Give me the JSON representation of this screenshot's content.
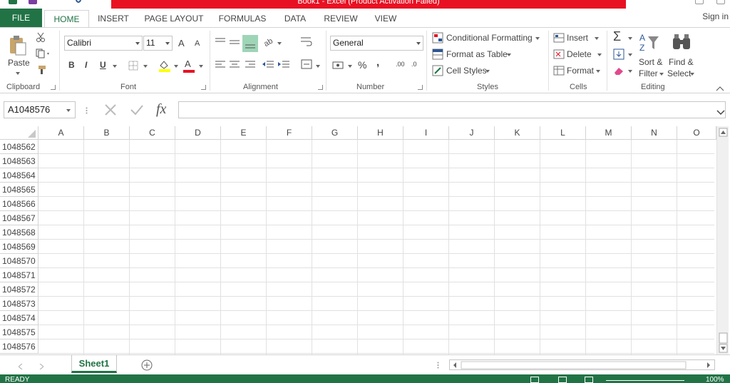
{
  "title_bar": {
    "title": "Book1 - Excel (Product Activation Failed)"
  },
  "tabs": [
    {
      "label": "FILE",
      "key": "file"
    },
    {
      "label": "HOME",
      "key": "home"
    },
    {
      "label": "INSERT",
      "key": "insert"
    },
    {
      "label": "PAGE LAYOUT",
      "key": "page-layout"
    },
    {
      "label": "FORMULAS",
      "key": "formulas"
    },
    {
      "label": "DATA",
      "key": "data"
    },
    {
      "label": "REVIEW",
      "key": "review"
    },
    {
      "label": "VIEW",
      "key": "view"
    }
  ],
  "active_tab": "HOME",
  "signin": "Sign in",
  "ribbon": {
    "clipboard": {
      "label": "Clipboard",
      "paste": "Paste"
    },
    "font": {
      "label": "Font",
      "name": "Calibri",
      "size": "11",
      "bold": "B",
      "italic": "I",
      "underline": "U",
      "grow": "A",
      "shrink": "A",
      "fontcolor": "A"
    },
    "alignment": {
      "label": "Alignment"
    },
    "number": {
      "label": "Number",
      "format": "General",
      "percent": "%",
      "comma": ",",
      "inc_decimal": ".00",
      "dec_decimal": ".0"
    },
    "styles": {
      "label": "Styles",
      "conditional": "Conditional Formatting",
      "table": "Format as Table",
      "cell_styles": "Cell Styles"
    },
    "cells": {
      "label": "Cells",
      "insert": "Insert",
      "delete": "Delete",
      "format": "Format"
    },
    "editing": {
      "label": "Editing",
      "sort_line1": "Sort &",
      "sort_line2": "Filter",
      "find_line1": "Find &",
      "find_line2": "Select",
      "sigma": "Σ"
    }
  },
  "formula_bar": {
    "name_box": "A1048576",
    "fx": "fx",
    "value": ""
  },
  "columns": [
    "A",
    "B",
    "C",
    "D",
    "E",
    "F",
    "G",
    "H",
    "I",
    "J",
    "K",
    "L",
    "M",
    "N",
    "O"
  ],
  "rows": [
    "1048562",
    "1048563",
    "1048564",
    "1048565",
    "1048566",
    "1048567",
    "1048568",
    "1048569",
    "1048570",
    "1048571",
    "1048572",
    "1048573",
    "1048574",
    "1048575",
    "1048576"
  ],
  "sheets": [
    {
      "name": "Sheet1"
    }
  ],
  "status": {
    "text": "READY",
    "zoom": "100%"
  },
  "colors": {
    "excel_green": "#217346",
    "title_error_red": "#e81123"
  }
}
